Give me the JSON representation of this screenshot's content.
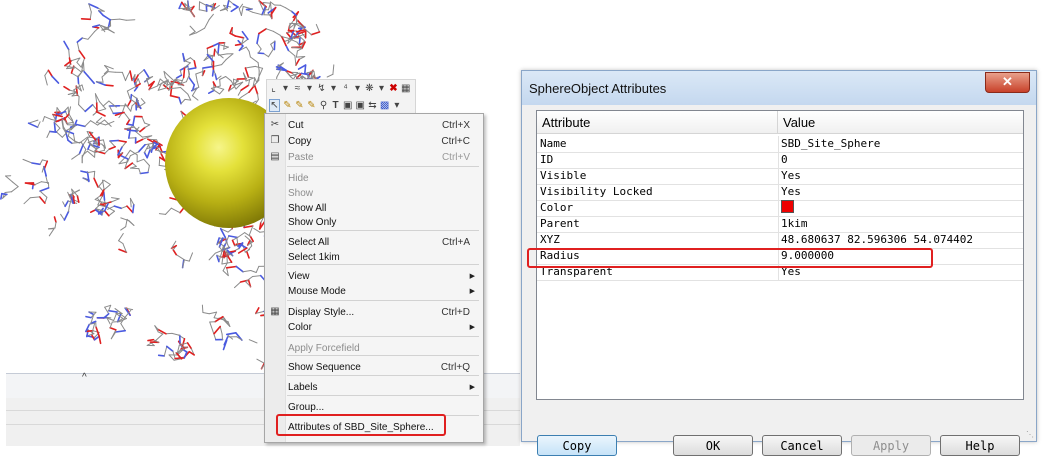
{
  "context_menu": {
    "items": [
      {
        "icon": "scissors-icon",
        "label": "Cut",
        "shortcut": "Ctrl+X",
        "enabled": true
      },
      {
        "icon": "copy-icon",
        "label": "Copy",
        "shortcut": "Ctrl+C",
        "enabled": true
      },
      {
        "icon": "paste-icon",
        "label": "Paste",
        "shortcut": "Ctrl+V",
        "enabled": false
      },
      {
        "label": "Hide",
        "enabled": false
      },
      {
        "label": "Show",
        "enabled": false
      },
      {
        "label": "Show All",
        "enabled": true
      },
      {
        "label": "Show Only",
        "enabled": true
      },
      {
        "label": "Select All",
        "shortcut": "Ctrl+A",
        "enabled": true
      },
      {
        "label": "Select 1kim",
        "enabled": true
      },
      {
        "label": "View",
        "submenu": true,
        "enabled": true
      },
      {
        "label": "Mouse Mode",
        "submenu": true,
        "enabled": true
      },
      {
        "icon": "display-style-icon",
        "label": "Display Style...",
        "shortcut": "Ctrl+D",
        "enabled": true
      },
      {
        "label": "Color",
        "submenu": true,
        "enabled": true
      },
      {
        "label": "Apply Forcefield",
        "enabled": false
      },
      {
        "label": "Show Sequence",
        "shortcut": "Ctrl+Q",
        "enabled": true
      },
      {
        "label": "Labels",
        "submenu": true,
        "enabled": true
      },
      {
        "label": "Group...",
        "enabled": true
      },
      {
        "label": "Attributes of SBD_Site_Sphere...",
        "enabled": true,
        "highlighted": true
      }
    ]
  },
  "dialog": {
    "title": "SphereObject Attributes",
    "close_glyph": "✕",
    "columns": [
      "Attribute",
      "Value"
    ],
    "rows": [
      {
        "attribute": "Name",
        "value": "SBD_Site_Sphere"
      },
      {
        "attribute": "ID",
        "value": "0"
      },
      {
        "attribute": "Visible",
        "value": "Yes"
      },
      {
        "attribute": "Visibility Locked",
        "value": "Yes"
      },
      {
        "attribute": "Color",
        "value": "",
        "swatch": "#ee0000"
      },
      {
        "attribute": "Parent",
        "value": "1kim"
      },
      {
        "attribute": "XYZ",
        "value": "48.680637 82.596306 54.074402"
      },
      {
        "attribute": "Radius",
        "value": "9.000000",
        "highlighted": true
      },
      {
        "attribute": "Transparent",
        "value": "Yes"
      }
    ],
    "buttons": {
      "copy": "Copy",
      "ok": "OK",
      "cancel": "Cancel",
      "apply": "Apply",
      "help": "Help"
    }
  },
  "colors": {
    "highlight": "#e02020",
    "sphere": "#c8c220",
    "carbon_bond": "#8a8a8a",
    "oxygen_bond": "#e02020",
    "nitrogen_bond": "#4a5ae0"
  }
}
